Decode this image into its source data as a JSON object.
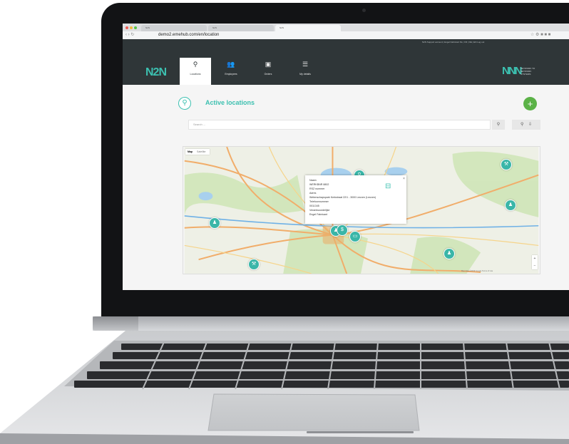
{
  "browser": {
    "tabs": [
      {
        "title": "N2N"
      },
      {
        "title": "N2N"
      },
      {
        "title": "N2N"
      }
    ],
    "url": "demo2.emehub.com/en/location"
  },
  "app": {
    "top_info": "N2N Support account | Engel Fabricant   NL | FR | DE | EN   Log out",
    "logo": "N2N",
    "brand_logo": "NNN",
    "brand_sub": "NETWORK TO NETWORK SYSTEMS",
    "nav": [
      {
        "label": "Locations",
        "icon": "pin-icon",
        "glyph": "⚲",
        "active": true
      },
      {
        "label": "Employees",
        "icon": "users-icon",
        "glyph": "👥",
        "active": false
      },
      {
        "label": "Orders",
        "icon": "clipboard-icon",
        "glyph": "▣",
        "active": false
      },
      {
        "label": "My details",
        "icon": "list-icon",
        "glyph": "☰",
        "active": false
      }
    ]
  },
  "page": {
    "title": "Active locations",
    "search_placeholder": "Search ..."
  },
  "map": {
    "toggle": [
      "Map",
      "Satellite"
    ],
    "popup_lines": [
      "Naam",
      "WERKBNR 8802",
      "RSZ nummer",
      "Adres",
      "Wetenschapspark Kerkstraat 22/1 - 3000 Leuven (Leuven)",
      "Telefoonnummer",
      "0011345",
      "Verantwoordelijke",
      "Engel Fabricant"
    ],
    "footer": "Map data ©2019 Google   Terms of Use",
    "marker_color": "#3ab6a8"
  },
  "colors": {
    "accent": "#3cc0b0",
    "add_button": "#5bb247",
    "header_bg": "#2f3638"
  }
}
